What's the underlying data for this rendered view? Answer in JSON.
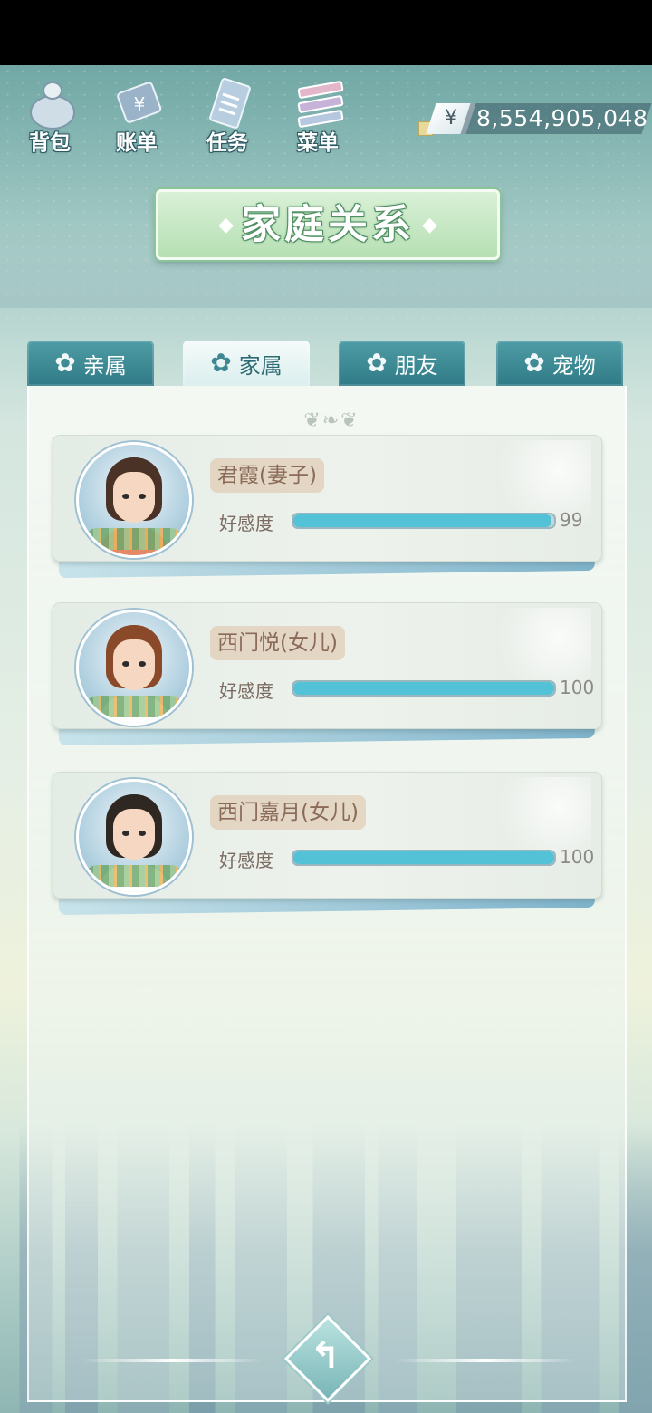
{
  "nav": {
    "items": [
      {
        "label": "背包",
        "icon": "bag-icon"
      },
      {
        "label": "账单",
        "icon": "bill-icon"
      },
      {
        "label": "任务",
        "icon": "task-icon"
      },
      {
        "label": "菜单",
        "icon": "menu-icon"
      }
    ]
  },
  "money": {
    "symbol": "¥",
    "amount": "8,554,905,048"
  },
  "title": "家庭关系",
  "tabs": [
    {
      "label": "亲属",
      "active": false
    },
    {
      "label": "家属",
      "active": true
    },
    {
      "label": "朋友",
      "active": false
    },
    {
      "label": "宠物",
      "active": false
    }
  ],
  "relations": [
    {
      "name": "君霞(妻子)",
      "favor_label": "好感度",
      "favor": "99",
      "favor_fraction": 0.99,
      "hair": "#4a3326",
      "clothes": "#e58866"
    },
    {
      "name": "西门悦(女儿)",
      "favor_label": "好感度",
      "favor": "100",
      "favor_fraction": 1.0,
      "hair": "#8a4a2a",
      "clothes": "#ffffff"
    },
    {
      "name": "西门嘉月(女儿)",
      "favor_label": "好感度",
      "favor": "100",
      "favor_fraction": 1.0,
      "hair": "#2f2722",
      "clothes": "#ffffff"
    }
  ],
  "colors": {
    "accent": "#54c2d6",
    "tab": "#2f7a86"
  }
}
